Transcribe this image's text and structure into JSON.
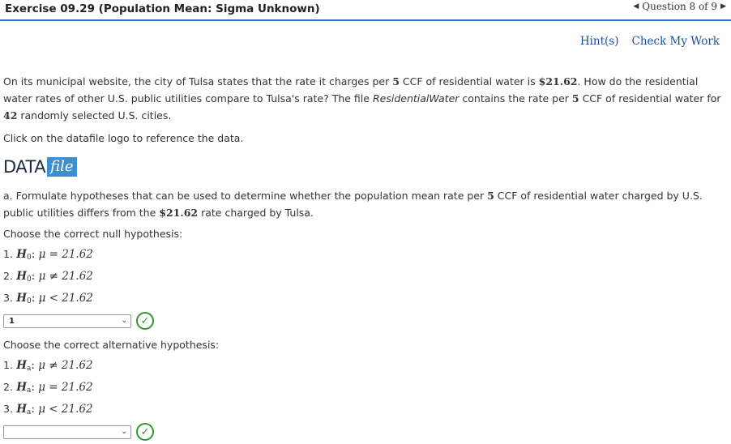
{
  "header": {
    "title": "Exercise 09.29 (Population Mean: Sigma Unknown)",
    "question_nav": "Question 8 of 9"
  },
  "links": {
    "hints": "Hint(s)",
    "check": "Check My Work"
  },
  "intro": {
    "t1": "On its municipal website, the city of Tulsa states that the rate it charges per ",
    "n1": "5",
    "t2": " CCF of residential water is ",
    "n2": "$21.62",
    "t3": ". How do the residential water rates of other U.S. public utilities compare to Tulsa's rate? The file ",
    "filename": "ResidentialWater",
    "t4": " contains the rate per ",
    "n3": "5",
    "t5": " CCF of residential water for ",
    "n4": "42",
    "t6": " randomly selected U.S. cities."
  },
  "click_note": "Click on the datafile logo to reference the data.",
  "datafile_logo": {
    "data": "DATA",
    "file": "file"
  },
  "part_a": {
    "t1": "a. Formulate hypotheses that can be used to determine whether the population mean rate per ",
    "n1": "5",
    "t2": " CCF of residential water charged by U.S. public utilities differs from the ",
    "n2": "$21.62",
    "t3": " rate charged by Tulsa."
  },
  "null_prompt": "Choose the correct null hypothesis:",
  "null_options": [
    {
      "num": "1.",
      "sym": "H",
      "sub": "0",
      "rel": "μ = 21.62"
    },
    {
      "num": "2.",
      "sym": "H",
      "sub": "0",
      "rel": "μ ≠ 21.62"
    },
    {
      "num": "3.",
      "sym": "H",
      "sub": "0",
      "rel": "μ < 21.62"
    }
  ],
  "null_select": {
    "value": "1"
  },
  "alt_prompt": "Choose the correct alternative hypothesis:",
  "alt_options": [
    {
      "num": "1.",
      "sym": "H",
      "sub": "a",
      "rel": "μ ≠ 21.62"
    },
    {
      "num": "2.",
      "sym": "H",
      "sub": "a",
      "rel": "μ = 21.62"
    },
    {
      "num": "3.",
      "sym": "H",
      "sub": "a",
      "rel": "μ < 21.62"
    }
  ],
  "icons": {
    "correct": "checkmark-icon",
    "chevron": "chevron-down-icon"
  },
  "colors": {
    "accent": "#2f6db5",
    "link": "#1a4fa0",
    "correct": "#2e9a2e",
    "datafile": "#3d8fd0"
  }
}
